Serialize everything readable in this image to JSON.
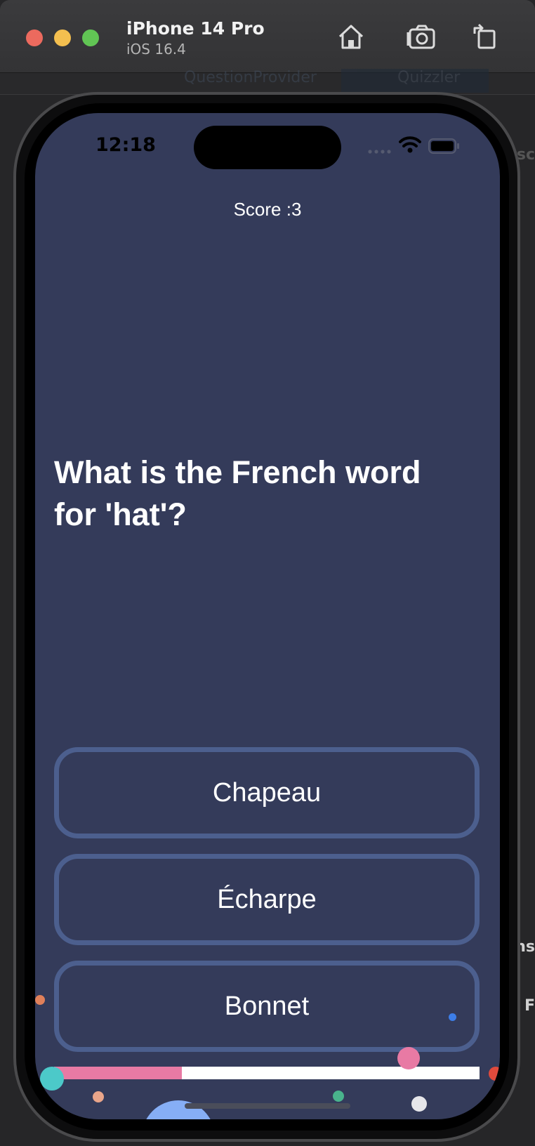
{
  "simulator": {
    "device_name": "iPhone 14 Pro",
    "os_version": "iOS 16.4",
    "icons": [
      "home-icon",
      "screenshot-icon",
      "rotate-icon"
    ]
  },
  "background_xcode": {
    "tab_1": "QuestionProvider",
    "tab_2": "Quizzler",
    "side_fragment_1": "ns",
    "side_fragment_2": "t F",
    "side_fragment_3": "esc"
  },
  "status_bar": {
    "time": "12:18",
    "icons": [
      "signal-icon",
      "wifi-icon",
      "battery-icon"
    ]
  },
  "quiz": {
    "score_text": "Score :3",
    "question": "What is the French word for 'hat'?",
    "answers": [
      "Chapeau",
      "Écharpe",
      "Bonnet"
    ],
    "progress_fraction": 0.3
  },
  "colors": {
    "screen_background": "#343b5a",
    "answer_border": "#4c5f8e",
    "progress_fill": "#e87aa4",
    "progress_track": "#ffffff"
  }
}
